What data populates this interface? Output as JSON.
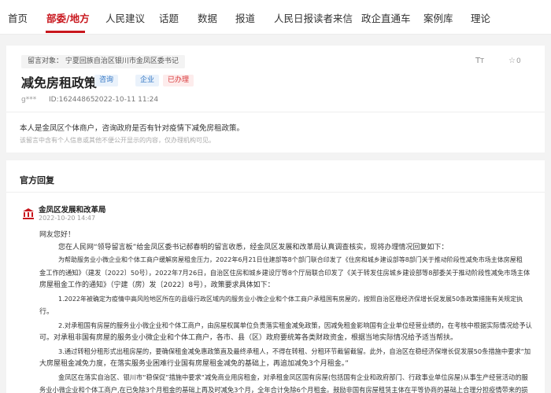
{
  "nav": {
    "items": [
      "首页",
      "部委/地方",
      "人民建议",
      "话题",
      "数据",
      "报道",
      "人民日报读者来信",
      "政企直通车",
      "案例库",
      "理论"
    ],
    "active_index": 1,
    "accent_color": "#c8161d"
  },
  "message": {
    "target": "留言对象：  宁夏回族自治区银川市金凤区委书记",
    "title": "减免房租政策",
    "tags": {
      "type": "咨询",
      "field": "企业",
      "status": "已办理"
    },
    "author": "g***",
    "id": "ID:16244865",
    "date": "2022-10-11 11:24",
    "favorites": "0",
    "content": "本人是金凤区个体商户，咨询政府是否有针对疫情下减免房租政策。",
    "notice": "该留言中含有个人信息或其他不便公开显示的内容，仅办理机构可见。"
  },
  "reply": {
    "heading": "官方回复",
    "org": "金凤区发展和改革局",
    "date": "2022-10-20 14:47",
    "lines": [
      "网友您好！",
      "您在人民网“领导留言板”给金凤区委书记郝春明的留言收悉，经金凤区发展和改革局认真调查核实，现将办理情况回复如下：",
      "为帮助服务业小微企业和个体工商户缓解房屋租金压力，2022年6月21日住建部等8个部门联合印发了《住房和城乡建设部等8部门关于推动阶段性减免市场主体房屋租",
      "金工作的通知》（建发〔2022〕50号），2022年7月26日，自治区住房和城乡建设厅等8个厅局联合印发了《关于转发住房城乡建设部等8部委关于推动阶段性减免市场主体",
      "房屋租金工作的通知》（宁建（房）发〔2022〕8号），政策要求具体如下：",
      "1.2022年被确定为疫情中高风险地区所在的县级行政区域内的服务业小微企业和个体工商户承租国有房屋的，按照自治区稳经济保增长促发展50条政策措施有关规定执",
      "行。",
      "2.对承租国有房屋的服务业小微企业和个体工商户，由房屋权属单位负责落实租金减免政策，因减免租金影响国有企业单位经营业绩的，在考核中根据实际情况给予认",
      "可。对承租非国有房屋的服务业小微企业和个体工商户，各市、县（区）政府要统筹各类财政资金，根据当地实际情况给予适当帮扶。",
      "3.通过转租分租形式出租房屋的，要确保租金减免惠政策直及最终承租人，不得在转租、分租环节截留截留。此外，自治区在稳经济保增长促发展50条措施中要求“加",
      "大房屋租金减免力度，在落实服务业困难行业国有房屋租金减免的基础上，再追加减免3个月租金。”",
      "金凤区在落实自治区、银川市“稳保促”措施中要求“减免商业用房租金，对承租金凤区国有房屋(包括国有企业和政府部门、行政事业单位房屋)从事生产经营活动的服",
      "务业小微企业和个体工商户,在已免除3个月租金的基础上再及时减免3个月，全年合计免除6个月租金。鼓励非国有房屋租赁主体在平等协商的基础上合理分担疫情带来的损"
    ]
  }
}
